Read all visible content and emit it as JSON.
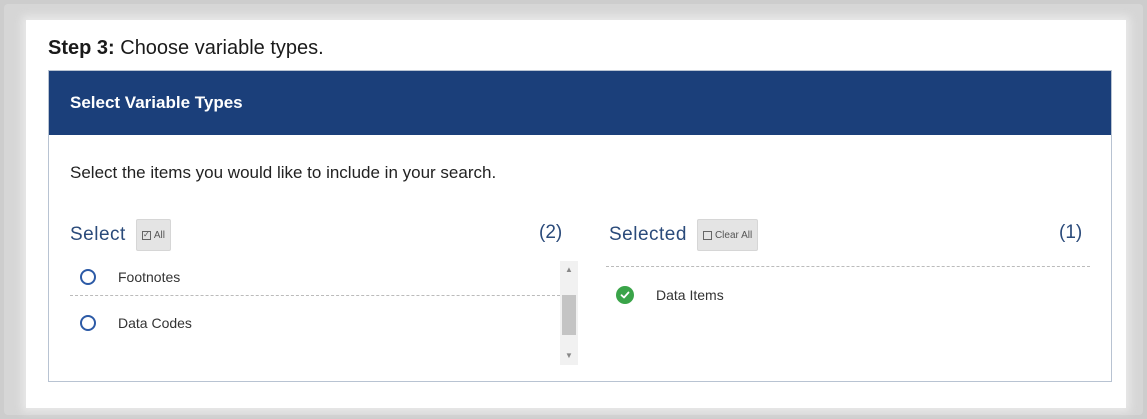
{
  "step": {
    "label": "Step 3:",
    "text": " Choose variable types."
  },
  "panel": {
    "title": "Select Variable Types",
    "instructions": "Select the items you would like to include in your search."
  },
  "select_column": {
    "label": "Select",
    "button_label": "All",
    "count": "(2)",
    "items": [
      {
        "label": "Footnotes",
        "selected": false
      },
      {
        "label": "Data Codes",
        "selected": false
      }
    ]
  },
  "selected_column": {
    "label": "Selected",
    "button_label": "Clear All",
    "count": "(1)",
    "items": [
      {
        "label": "Data Items",
        "selected": true
      }
    ]
  },
  "colors": {
    "header_bg": "#1b3f7a",
    "accent_blue": "#2c5aa6",
    "check_green": "#3aa449"
  },
  "icons": {
    "radio": "radio-unchecked-icon",
    "check": "check-circle-icon",
    "all_checkbox": "checkbox-checked-icon",
    "clear_checkbox": "checkbox-empty-icon"
  }
}
